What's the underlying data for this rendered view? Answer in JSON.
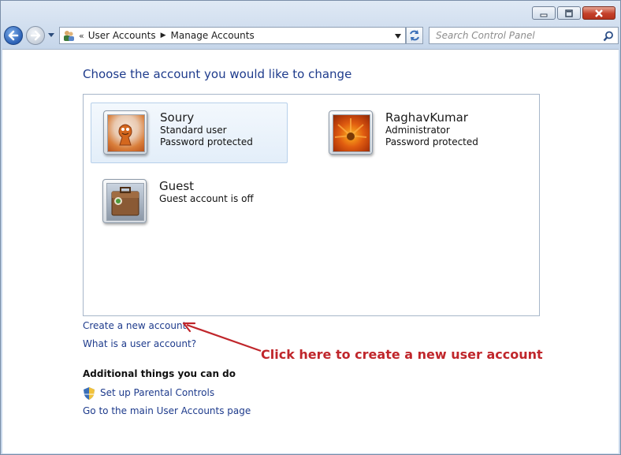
{
  "window": {
    "minimize_icon": "minimize-icon",
    "maximize_icon": "maximize-icon",
    "close_icon": "close-icon"
  },
  "navigation": {
    "breadcrumb_icon": "user-accounts-icon",
    "breadcrumb_overflow": "«",
    "crumbs": [
      "User Accounts",
      "Manage Accounts"
    ],
    "search_placeholder": "Search Control Panel"
  },
  "main": {
    "heading": "Choose the account you would like to change",
    "accounts": [
      {
        "name": "Soury",
        "type": "Standard user",
        "status": "Password protected",
        "picture": "chess-piece",
        "selected": true
      },
      {
        "name": "RaghavKumar",
        "type": "Administrator",
        "status": "Password protected",
        "picture": "orange-flower",
        "selected": false
      },
      {
        "name": "Guest",
        "type": "Guest account is off",
        "status": "",
        "picture": "briefcase",
        "selected": false
      }
    ],
    "links": {
      "create_account": "Create a new account",
      "what_is_account": "What is a user account?"
    },
    "annotation": "Click here to create a new user account",
    "additional": {
      "heading": "Additional things you can do",
      "parental_controls": "Set up Parental Controls",
      "main_page": "Go to the main User Accounts page"
    }
  },
  "colors": {
    "link": "#1e3b8c",
    "annotation": "#c0262b"
  }
}
